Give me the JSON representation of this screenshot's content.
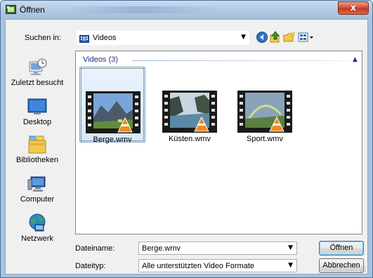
{
  "window": {
    "title": "Öffnen",
    "close_label": "x"
  },
  "lookin": {
    "label": "Suchen in:",
    "value": "Videos"
  },
  "toolbar": {
    "back_icon": "back-icon",
    "up_icon": "up-folder-icon",
    "new_folder_icon": "new-folder-icon",
    "views_icon": "views-menu-icon"
  },
  "places": [
    {
      "label": "Zuletzt besucht",
      "icon": "recent-places-icon"
    },
    {
      "label": "Desktop",
      "icon": "desktop-icon"
    },
    {
      "label": "Bibliotheken",
      "icon": "libraries-icon"
    },
    {
      "label": "Computer",
      "icon": "computer-icon"
    },
    {
      "label": "Netzwerk",
      "icon": "network-icon"
    }
  ],
  "filelist": {
    "group_header": "Videos (3)",
    "files": [
      {
        "name": "Berge.wmv",
        "selected": true
      },
      {
        "name": "Küsten.wmv",
        "selected": false
      },
      {
        "name": "Sport.wmv",
        "selected": false
      }
    ]
  },
  "filename": {
    "label": "Dateiname:",
    "value": "Berge.wmv"
  },
  "filetype": {
    "label": "Dateityp:",
    "value": "Alle unterstützten Video Formate"
  },
  "buttons": {
    "open": "Öffnen",
    "cancel": "Abbrechen"
  },
  "colors": {
    "titlebar": "#b4cce6",
    "selection": "#d7e8fc",
    "group_header": "#1e3287",
    "close": "#c23a20"
  }
}
